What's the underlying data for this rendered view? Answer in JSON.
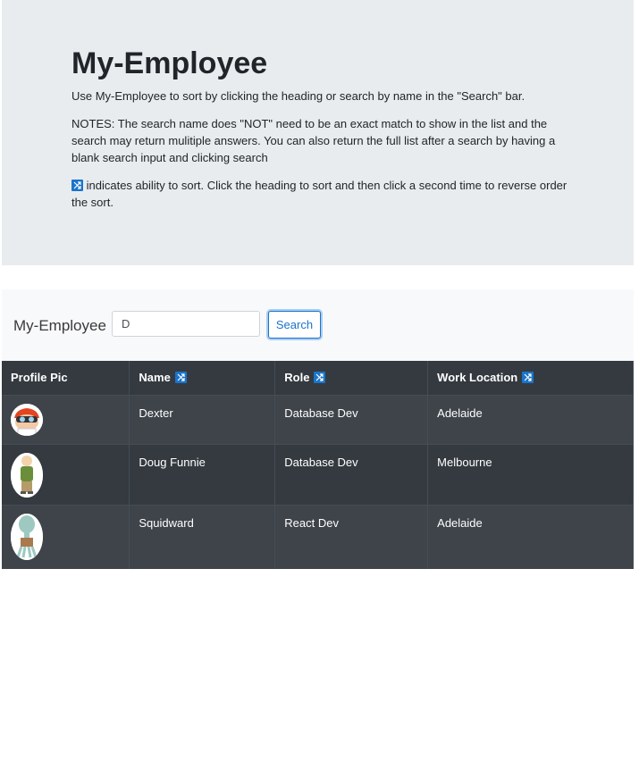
{
  "header": {
    "title": "My-Employee",
    "intro": "Use My-Employee to sort by clicking the heading or search by name in the \"Search\" bar.",
    "notes": "NOTES: The search name does \"NOT\" need to be an exact match to show in the list and the search may return mulitiple answers. You can also return the full list after a search by having a blank search input and clicking search",
    "sort_hint": "indicates ability to sort. Click the heading to sort and then click a second time to reverse order the sort."
  },
  "navbar": {
    "brand": "My-Employee",
    "search_value": "D",
    "search_button": "Search"
  },
  "table": {
    "columns": [
      "Profile Pic",
      "Name",
      "Role",
      "Work Location"
    ],
    "rows": [
      {
        "name": "Dexter",
        "role": "Database Dev",
        "location": "Adelaide",
        "avatar": "dexter-avatar"
      },
      {
        "name": "Doug Funnie",
        "role": "Database Dev",
        "location": "Melbourne",
        "avatar": "doug-avatar"
      },
      {
        "name": "Squidward",
        "role": "React Dev",
        "location": "Adelaide",
        "avatar": "squidward-avatar"
      }
    ]
  },
  "colors": {
    "accent": "#1a74c9",
    "header_bg": "#e9ecef",
    "table_bg": "#343a40"
  }
}
